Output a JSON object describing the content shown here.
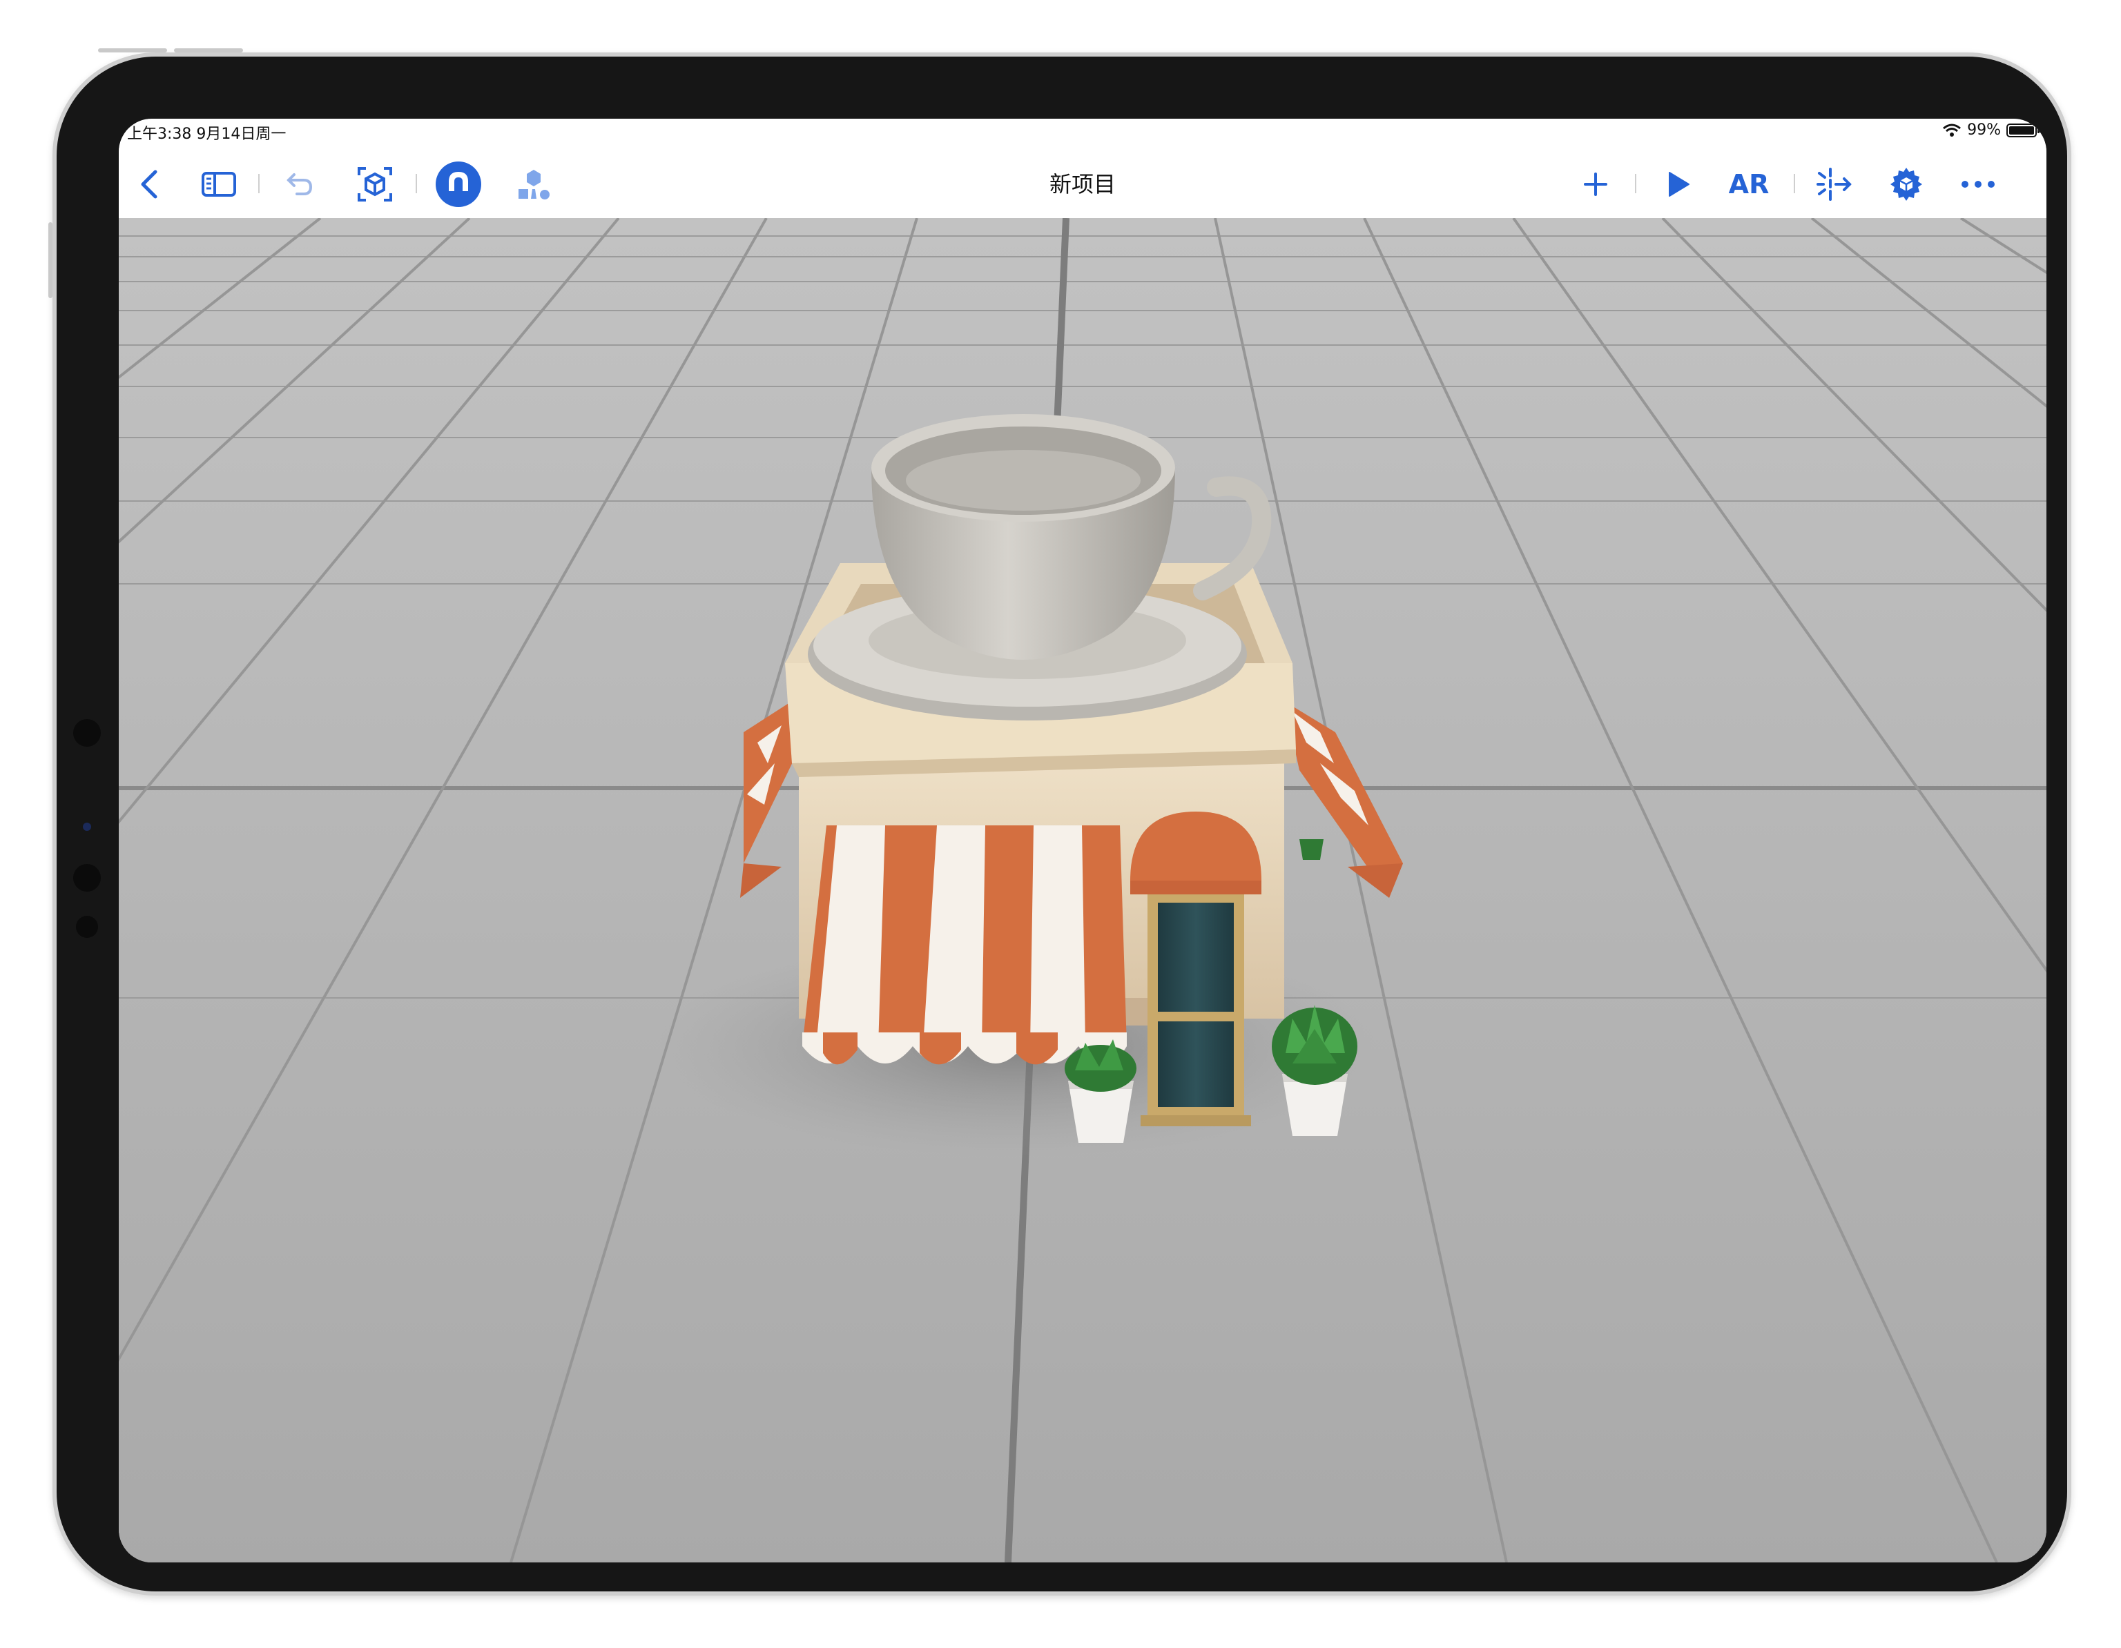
{
  "status_bar": {
    "time": "上午3:38   9月14日周一",
    "battery_text": "99%",
    "battery_level": 0.99
  },
  "toolbar": {
    "title": "新项目",
    "left_icons": [
      "back-chevron-icon",
      "sidebar-icon",
      "undo-icon",
      "scan-box-icon",
      "snap-magnet-icon",
      "physics-objects-icon"
    ],
    "right_icons": [
      "add-icon",
      "play-icon",
      "ar-icon",
      "transform-arrows-icon",
      "gear-cube-icon",
      "more-icon"
    ],
    "ar_label": "AR",
    "accent_color": "#2563d6"
  },
  "scene": {
    "objects": [
      "coffee-shop-building",
      "teacup-on-saucer",
      "potted-plant-left",
      "potted-plant-right"
    ]
  }
}
